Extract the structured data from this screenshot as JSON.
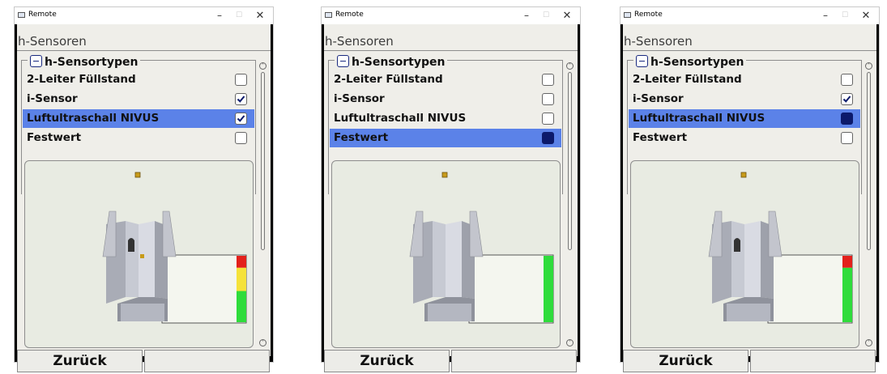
{
  "panels": [
    {
      "window_title": "Remote",
      "heading": "h-Sensoren",
      "group_title": "h-Sensortypen",
      "rows": [
        {
          "label": "2-Leiter Füllstand",
          "selected": false,
          "checked": false
        },
        {
          "label": "i-Sensor",
          "selected": false,
          "checked": true
        },
        {
          "label": "Luftultraschall NIVUS",
          "selected": true,
          "checked": true
        },
        {
          "label": "Festwert",
          "selected": false,
          "checked": false
        }
      ],
      "level_bar": [
        {
          "color": "#e3201b",
          "fraction": 0.18
        },
        {
          "color": "#f5e23a",
          "fraction": 0.35
        },
        {
          "color": "#2edc3b",
          "fraction": 0.47
        }
      ],
      "softkeys": [
        "Zurück",
        ""
      ]
    },
    {
      "window_title": "Remote",
      "heading": "h-Sensoren",
      "group_title": "h-Sensortypen",
      "rows": [
        {
          "label": "2-Leiter Füllstand",
          "selected": false,
          "checked": false
        },
        {
          "label": "i-Sensor",
          "selected": false,
          "checked": false
        },
        {
          "label": "Luftultraschall NIVUS",
          "selected": false,
          "checked": false
        },
        {
          "label": "Festwert",
          "selected": true,
          "checked": "filled"
        }
      ],
      "level_bar": [
        {
          "color": "#2edc3b",
          "fraction": 1.0
        }
      ],
      "softkeys": [
        "Zurück",
        ""
      ]
    },
    {
      "window_title": "Remote",
      "heading": "h-Sensoren",
      "group_title": "h-Sensortypen",
      "rows": [
        {
          "label": "2-Leiter Füllstand",
          "selected": false,
          "checked": false
        },
        {
          "label": "i-Sensor",
          "selected": false,
          "checked": true
        },
        {
          "label": "Luftultraschall NIVUS",
          "selected": true,
          "checked": "filled"
        },
        {
          "label": "Festwert",
          "selected": false,
          "checked": false
        }
      ],
      "level_bar": [
        {
          "color": "#e3201b",
          "fraction": 0.18
        },
        {
          "color": "#2edc3b",
          "fraction": 0.82
        }
      ],
      "softkeys": [
        "Zurück",
        ""
      ]
    }
  ],
  "colors": {
    "accent": "#5b82e8",
    "checkbox_fill": "#0c1a6b",
    "screen_bg": "#efeee9"
  }
}
